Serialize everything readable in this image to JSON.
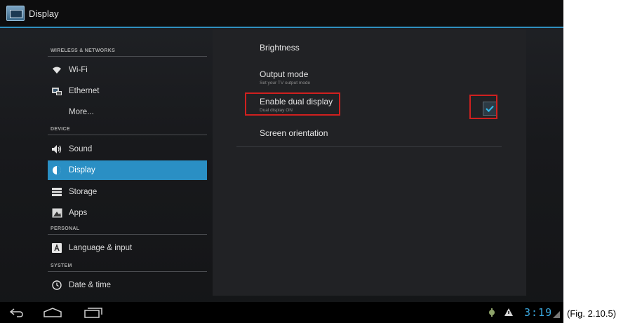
{
  "window": {
    "title": "Display",
    "icon": "settings-display-app-icon"
  },
  "headers": {
    "categories": {
      "wireless": "WIRELESS & NETWORKS",
      "device": "DEVICE",
      "personal": "PERSONAL",
      "system": "SYSTEM"
    },
    "items": {
      "wifi": "Wi-Fi",
      "ethernet": "Ethernet",
      "more": "More...",
      "sound": "Sound",
      "display": "Display",
      "storage": "Storage",
      "apps": "Apps",
      "language": "Language & input",
      "datetime": "Date & time"
    },
    "selected": "Display"
  },
  "content": {
    "brightness": {
      "title": "Brightness"
    },
    "output_mode": {
      "title": "Output mode",
      "summary": "Set your TV output mode"
    },
    "dual_display": {
      "title": "Enable dual display",
      "summary": "Dual display ON",
      "checked": true
    },
    "screen_orientation": {
      "title": "Screen orientation"
    }
  },
  "status_bar": {
    "clock": "3:19"
  },
  "caption": "(Fig. 2.10.5)",
  "colors": {
    "accent": "#2a8fc4",
    "highlight_box": "#d0201f",
    "clock": "#3aa6dc"
  }
}
